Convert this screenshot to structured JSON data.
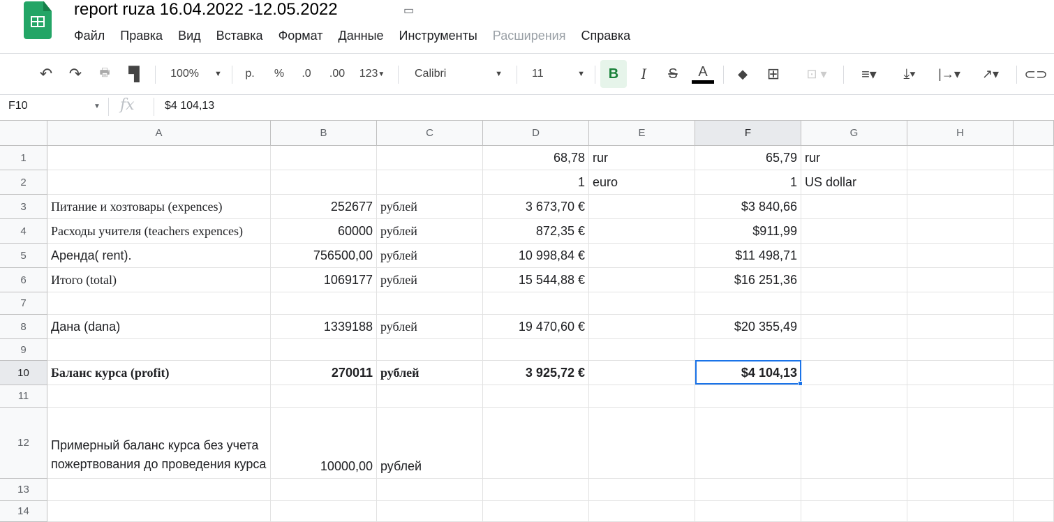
{
  "doc": {
    "title": "report ruza 16.04.2022 -12.05.2022"
  },
  "menu": [
    "Файл",
    "Правка",
    "Вид",
    "Вставка",
    "Формат",
    "Данные",
    "Инструменты",
    "Расширения",
    "Справка"
  ],
  "toolbar": {
    "zoom": "100%",
    "currency": "р.",
    "percent": "%",
    "dec_less": ".0",
    "dec_more": ".00",
    "format": "123",
    "font": "Calibri",
    "font_size": "11",
    "bold": "B",
    "italic": "I",
    "strike": "S",
    "text_color": "A",
    "text_color_value": "#000000",
    "accent": "#1a73e8"
  },
  "formula_bar": {
    "cell_ref": "F10",
    "fx": "fx",
    "value": "$4 104,13"
  },
  "columns": [
    "A",
    "B",
    "C",
    "D",
    "E",
    "F",
    "G",
    "H"
  ],
  "rows": [
    {
      "n": "1",
      "cells": {
        "D": "68,78",
        "E": "rur",
        "F": "65,79",
        "G": "rur"
      }
    },
    {
      "n": "2",
      "cells": {
        "D": "1",
        "E": "euro",
        "F": "1",
        "G": "US dollar"
      }
    },
    {
      "n": "3",
      "cells": {
        "A": "Питание и хозтовары (expences)",
        "B": "252677",
        "C": "рублей",
        "D": "3 673,70 €",
        "F": "$3 840,66"
      }
    },
    {
      "n": "4",
      "cells": {
        "A": "Расходы учителя (teachers expences)",
        "B": "60000",
        "C": "рублей",
        "D": "872,35 €",
        "F": "$911,99"
      }
    },
    {
      "n": "5",
      "cells": {
        "A": "Аренда( rent).",
        "B": "756500,00",
        "C": "рублей",
        "D": "10 998,84 €",
        "F": "$11 498,71"
      }
    },
    {
      "n": "6",
      "cells": {
        "A": "Итого (total)",
        "B": "1069177",
        "C": "рублей",
        "D": "15 544,88 €",
        "F": "$16 251,36"
      }
    },
    {
      "n": "7",
      "cells": {}
    },
    {
      "n": "8",
      "cells": {
        "A": "Дана (dana)",
        "B": "1339188",
        "C": "рублей",
        "D": "19 470,60 €",
        "F": "$20 355,49"
      }
    },
    {
      "n": "9",
      "cells": {}
    },
    {
      "n": "10",
      "cells": {
        "A": "Баланс курса (profit)",
        "B": "270011",
        "C": "рублей",
        "D": "3 925,72 €",
        "F": "$4 104,13"
      }
    },
    {
      "n": "11",
      "cells": {}
    },
    {
      "n": "12",
      "cells": {
        "A": "Примерный баланс курса без учета пожертвования до проведения курса",
        "B": "10000,00",
        "C": "рублей"
      }
    },
    {
      "n": "13",
      "cells": {}
    },
    {
      "n": "14",
      "cells": {}
    }
  ]
}
